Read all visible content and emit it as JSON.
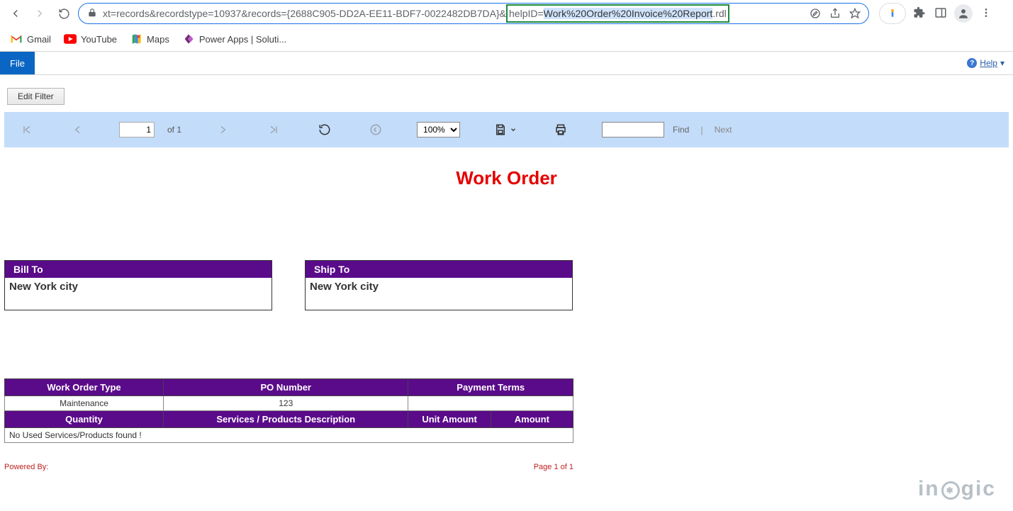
{
  "chrome": {
    "url_pre": "xt=records&recordstype=10937&records={2688C905-DD2A-EE11-BDF7-0022482DB7DA}&",
    "url_helpid_label": "helpID=",
    "url_selected": "Work%20Order%20Invoice%20Report",
    "url_suffix": ".rdl"
  },
  "bookmarks": {
    "gmail": "Gmail",
    "youtube": "YouTube",
    "maps": "Maps",
    "powerapps": "Power Apps | Soluti..."
  },
  "appbar": {
    "file": "File",
    "help": "Help"
  },
  "editFilter": "Edit Filter",
  "viewer": {
    "page_current": "1",
    "page_of": "of 1",
    "zoom": "100%",
    "find": "Find",
    "next": "Next"
  },
  "report": {
    "title": "Work Order",
    "bill_to_label": "Bill To",
    "bill_to_value": "New York city",
    "ship_to_label": "Ship To",
    "ship_to_value": "New York city",
    "headers1": {
      "wotype": "Work Order Type",
      "ponum": "PO Number",
      "terms": "Payment Terms"
    },
    "row1": {
      "wotype": "Maintenance",
      "ponum": "123",
      "terms": ""
    },
    "headers2": {
      "qty": "Quantity",
      "desc": "Services / Products Description",
      "unit": "Unit Amount",
      "amount": "Amount"
    },
    "no_items": "No Used Services/Products found !",
    "powered_by": "Powered By:",
    "page_info": "Page 1 of 1"
  },
  "logo": {
    "pre": "in",
    "mid": "✱",
    "post": "gic"
  }
}
